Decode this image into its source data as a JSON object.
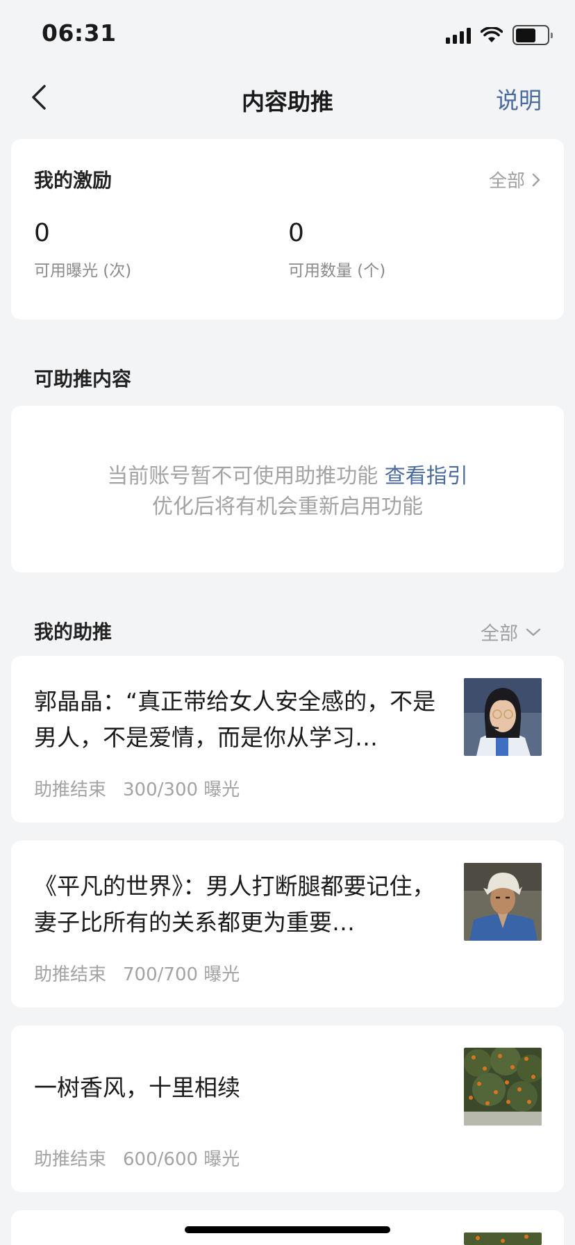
{
  "status_bar": {
    "time": "06:31",
    "battery_level": 0.65
  },
  "nav": {
    "title": "内容助推",
    "help_label": "说明"
  },
  "incentive": {
    "title": "我的激励",
    "all_label": "全部",
    "stats": [
      {
        "value": "0",
        "label": "可用曝光 (次)"
      },
      {
        "value": "0",
        "label": "可用数量 (个)"
      }
    ]
  },
  "promotable": {
    "title": "可助推内容",
    "empty_line1": "当前账号暂不可使用助推功能",
    "guide_label": "查看指引",
    "empty_line2": "优化后将有机会重新启用功能"
  },
  "my_promotions": {
    "title": "我的助推",
    "filter_label": "全部",
    "items": [
      {
        "title": "郭晶晶：“真正带给女人安全感的，不是男人，不是爱情，而是你从学习…",
        "status": "助推结束",
        "count": "300/300 曝光",
        "thumb_icon": "portrait-woman-headset"
      },
      {
        "title": "《平凡的世界》：男人打断腿都要记住，妻子比所有的关系都更为重要…",
        "status": "助推结束",
        "count": "700/700 曝光",
        "thumb_icon": "portrait-man-headscarf"
      },
      {
        "title": "一树香风，十里相续",
        "status": "助推结束",
        "count": "600/600 曝光",
        "thumb_icon": "osmanthus-tree"
      }
    ]
  },
  "colors": {
    "accent": "#4a6aa0",
    "background": "#f3f4f6",
    "muted": "#a3a3a3"
  }
}
